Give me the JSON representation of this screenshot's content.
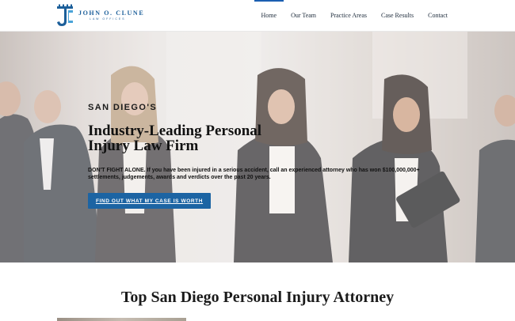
{
  "header": {
    "logo": {
      "name": "JOHN O. CLUNE",
      "subtitle": "LAW OFFICES",
      "icon": "jc-monogram-shield-icon"
    },
    "nav": [
      {
        "label": "Home",
        "active": true
      },
      {
        "label": "Our Team",
        "active": false
      },
      {
        "label": "Practice Areas",
        "active": false
      },
      {
        "label": "Case Results",
        "active": false
      },
      {
        "label": "Contact",
        "active": false
      }
    ]
  },
  "hero": {
    "eyebrow": "SAN DIEGO'S",
    "headline_line1": "Industry-Leading Personal",
    "headline_line2": "Injury Law Firm",
    "lead": "DON'T FIGHT ALONE. If you have been injured in a serious accident, call an experienced attorney who has won $100,000,000+ settlements, judgements, awards and verdicts over the past 20 years.",
    "cta_label": "FIND OUT WHAT MY CASE IS WORTH"
  },
  "section": {
    "title": "Top San Diego Personal Injury Attorney"
  },
  "colors": {
    "brand_blue": "#1c64a3",
    "nav_active": "#1b5fb1",
    "text_dark": "#111111"
  }
}
